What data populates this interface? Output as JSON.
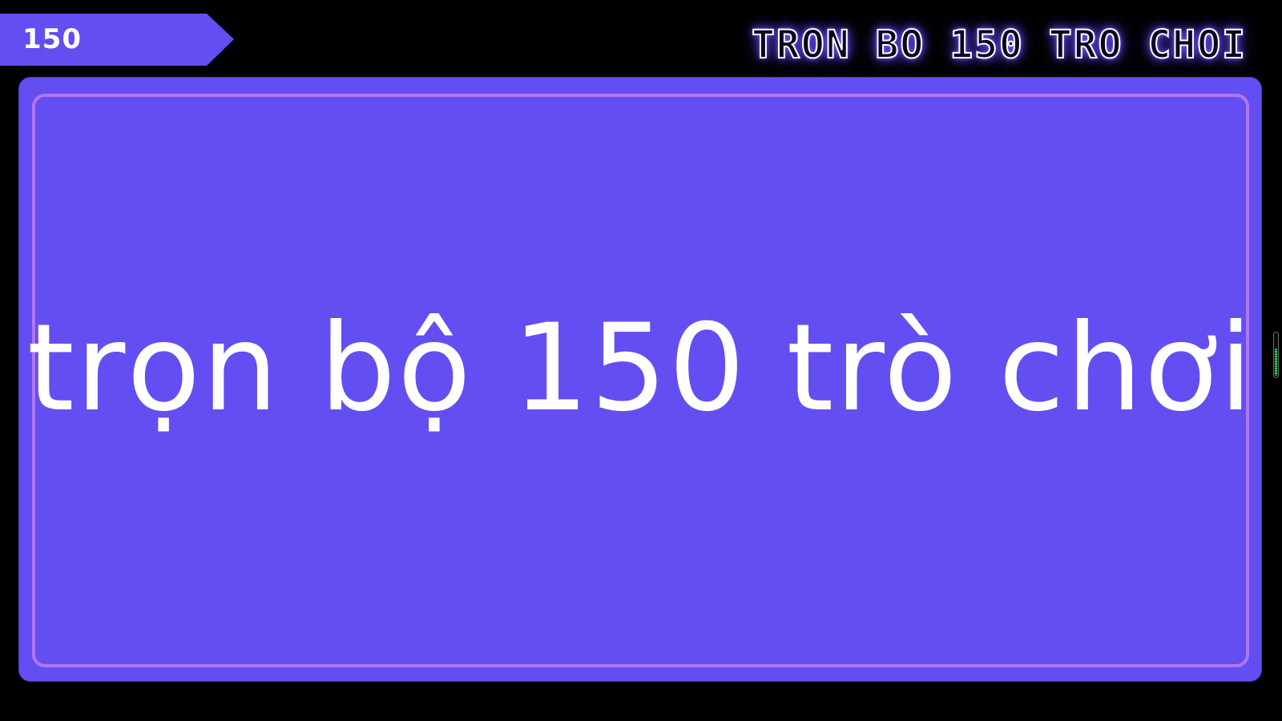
{
  "badge": {
    "label": "150"
  },
  "header": {
    "title": "TRON BO 150 TRO CHOI"
  },
  "card": {
    "headline": "trọn bộ 150 trò chơi"
  },
  "scroll_indicator": {
    "level": 0.6
  },
  "colors": {
    "background": "#000000",
    "accent": "#634ef2",
    "card_border": "#b276f0",
    "text": "#ffffff",
    "neon_glow": "#6b4cff",
    "indicator": "#2fd15a"
  }
}
